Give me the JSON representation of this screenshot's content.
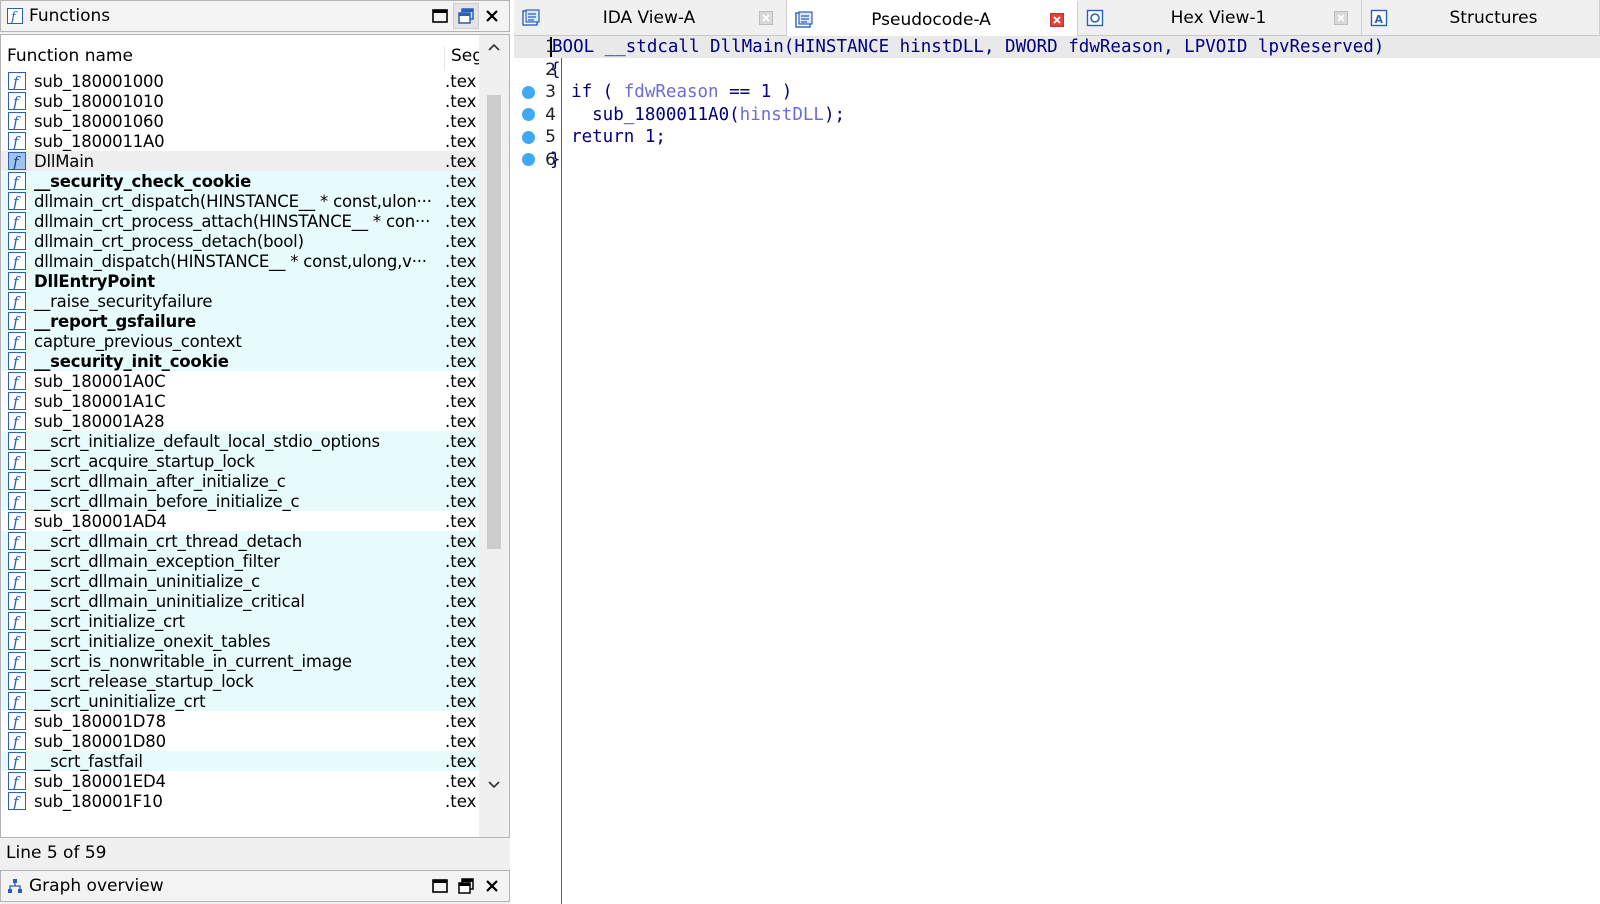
{
  "functions_panel": {
    "title": "Functions",
    "columns": {
      "name": "Function name",
      "segment": "Seg"
    },
    "rows": [
      {
        "name": "sub_180001000",
        "seg": ".tex",
        "bold": false,
        "lib": false
      },
      {
        "name": "sub_180001010",
        "seg": ".tex",
        "bold": false,
        "lib": false
      },
      {
        "name": "sub_180001060",
        "seg": ".tex",
        "bold": false,
        "lib": false
      },
      {
        "name": "sub_1800011A0",
        "seg": ".tex",
        "bold": false,
        "lib": false
      },
      {
        "name": "DllMain",
        "seg": ".tex",
        "bold": false,
        "lib": false,
        "selected": true
      },
      {
        "name": "__security_check_cookie",
        "seg": ".tex",
        "bold": true,
        "lib": true
      },
      {
        "name": "dllmain_crt_dispatch(HINSTANCE__ * const,ulon···",
        "seg": ".tex",
        "bold": false,
        "lib": true
      },
      {
        "name": "dllmain_crt_process_attach(HINSTANCE__ * con···",
        "seg": ".tex",
        "bold": false,
        "lib": true
      },
      {
        "name": "dllmain_crt_process_detach(bool)",
        "seg": ".tex",
        "bold": false,
        "lib": true
      },
      {
        "name": "dllmain_dispatch(HINSTANCE__ * const,ulong,v···",
        "seg": ".tex",
        "bold": false,
        "lib": true
      },
      {
        "name": "DllEntryPoint",
        "seg": ".tex",
        "bold": true,
        "lib": true
      },
      {
        "name": "__raise_securityfailure",
        "seg": ".tex",
        "bold": false,
        "lib": true
      },
      {
        "name": "__report_gsfailure",
        "seg": ".tex",
        "bold": true,
        "lib": true
      },
      {
        "name": "capture_previous_context",
        "seg": ".tex",
        "bold": false,
        "lib": true
      },
      {
        "name": "__security_init_cookie",
        "seg": ".tex",
        "bold": true,
        "lib": true
      },
      {
        "name": "sub_180001A0C",
        "seg": ".tex",
        "bold": false,
        "lib": false
      },
      {
        "name": "sub_180001A1C",
        "seg": ".tex",
        "bold": false,
        "lib": false
      },
      {
        "name": "sub_180001A28",
        "seg": ".tex",
        "bold": false,
        "lib": false
      },
      {
        "name": "__scrt_initialize_default_local_stdio_options",
        "seg": ".tex",
        "bold": false,
        "lib": true
      },
      {
        "name": "__scrt_acquire_startup_lock",
        "seg": ".tex",
        "bold": false,
        "lib": true
      },
      {
        "name": "__scrt_dllmain_after_initialize_c",
        "seg": ".tex",
        "bold": false,
        "lib": true
      },
      {
        "name": "__scrt_dllmain_before_initialize_c",
        "seg": ".tex",
        "bold": false,
        "lib": true
      },
      {
        "name": "sub_180001AD4",
        "seg": ".tex",
        "bold": false,
        "lib": false
      },
      {
        "name": "__scrt_dllmain_crt_thread_detach",
        "seg": ".tex",
        "bold": false,
        "lib": true
      },
      {
        "name": "__scrt_dllmain_exception_filter",
        "seg": ".tex",
        "bold": false,
        "lib": true
      },
      {
        "name": "__scrt_dllmain_uninitialize_c",
        "seg": ".tex",
        "bold": false,
        "lib": true
      },
      {
        "name": "__scrt_dllmain_uninitialize_critical",
        "seg": ".tex",
        "bold": false,
        "lib": true
      },
      {
        "name": "__scrt_initialize_crt",
        "seg": ".tex",
        "bold": false,
        "lib": true
      },
      {
        "name": "__scrt_initialize_onexit_tables",
        "seg": ".tex",
        "bold": false,
        "lib": true
      },
      {
        "name": "__scrt_is_nonwritable_in_current_image",
        "seg": ".tex",
        "bold": false,
        "lib": true
      },
      {
        "name": "__scrt_release_startup_lock",
        "seg": ".tex",
        "bold": false,
        "lib": true
      },
      {
        "name": "__scrt_uninitialize_crt",
        "seg": ".tex",
        "bold": false,
        "lib": true
      },
      {
        "name": "sub_180001D78",
        "seg": ".tex",
        "bold": false,
        "lib": false
      },
      {
        "name": "sub_180001D80",
        "seg": ".tex",
        "bold": false,
        "lib": false
      },
      {
        "name": "__scrt_fastfail",
        "seg": ".tex",
        "bold": false,
        "lib": true
      },
      {
        "name": "sub_180001ED4",
        "seg": ".tex",
        "bold": false,
        "lib": false
      },
      {
        "name": "sub_180001F10",
        "seg": ".tex",
        "bold": false,
        "lib": false
      }
    ],
    "status": "Line 5 of 59"
  },
  "graph_overview": {
    "title": "Graph overview"
  },
  "tabs": [
    {
      "label": "IDA View-A",
      "icon": "ida-view-icon",
      "active": false,
      "close_style": "gray"
    },
    {
      "label": "Pseudocode-A",
      "icon": "pseudocode-icon",
      "active": true,
      "close_style": "red"
    },
    {
      "label": "Hex View-1",
      "icon": "hex-view-icon",
      "active": false,
      "close_style": "gray"
    },
    {
      "label": "Structures",
      "icon": "structures-icon",
      "active": false,
      "close_style": "none"
    }
  ],
  "pseudocode": {
    "lines": [
      {
        "n": "1",
        "bp": false,
        "current": true,
        "parts": [
          [
            "BOOL __stdcall DllMain(HINSTANCE hinstDLL, DWORD fdwReason, LPVOID lpvReserved)",
            "blk"
          ]
        ]
      },
      {
        "n": "2",
        "bp": false,
        "current": false,
        "parts": [
          [
            "{",
            "blk"
          ]
        ]
      },
      {
        "n": "3",
        "bp": true,
        "current": false,
        "parts": [
          [
            "  if ( ",
            "blk"
          ],
          [
            "fdwReason",
            "var"
          ],
          [
            " == 1 )",
            "blk"
          ]
        ]
      },
      {
        "n": "4",
        "bp": true,
        "current": false,
        "parts": [
          [
            "    sub_1800011A0(",
            "blk"
          ],
          [
            "hinstDLL",
            "var"
          ],
          [
            ");",
            "blk"
          ]
        ]
      },
      {
        "n": "5",
        "bp": true,
        "current": false,
        "parts": [
          [
            "  return 1;",
            "blk"
          ]
        ]
      },
      {
        "n": "6",
        "bp": true,
        "current": false,
        "parts": [
          [
            "}",
            "blk"
          ]
        ]
      }
    ]
  },
  "colors": {
    "library_row": "#e8fbfc",
    "selected_row": "#eeeeee",
    "code_text": "#000080",
    "code_variable": "#6c6cd6",
    "breakpoint": "#3fa9f5",
    "gutter_line": "#2c5fd6",
    "close_red": "#e0443c"
  }
}
